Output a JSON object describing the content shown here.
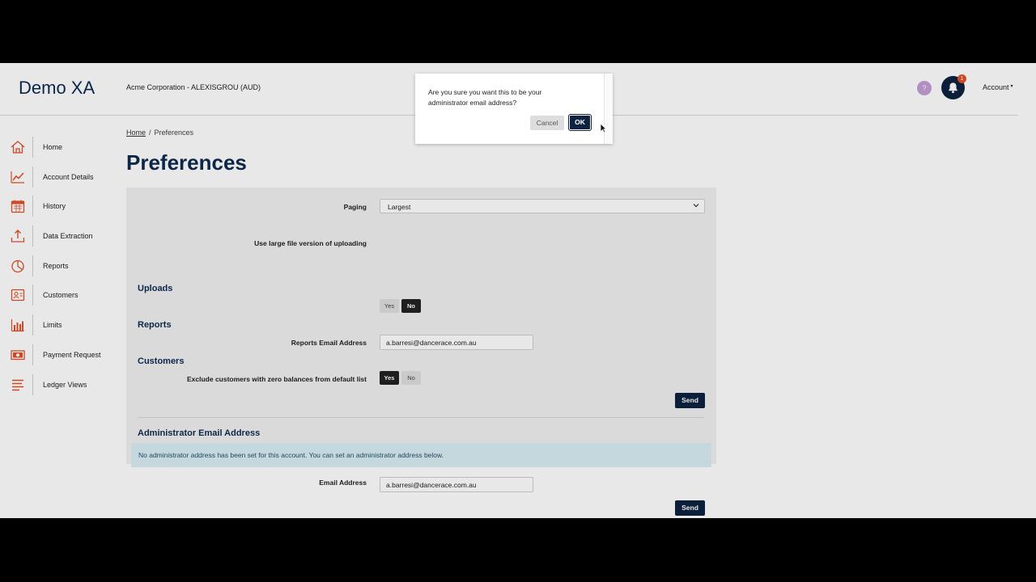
{
  "header": {
    "brand": "Demo XA",
    "organization": "Acme Corporation - ALEXISGROU (AUD)",
    "help_label": "?",
    "notification_count": "1",
    "account_label": "Account",
    "account_caret": "▾"
  },
  "sidebar": {
    "items": [
      {
        "label": "Home",
        "icon": "home-icon"
      },
      {
        "label": "Account Details",
        "icon": "line-chart-icon"
      },
      {
        "label": "History",
        "icon": "calendar-icon"
      },
      {
        "label": "Data Extraction",
        "icon": "upload-tray-icon"
      },
      {
        "label": "Reports",
        "icon": "pie-chart-icon"
      },
      {
        "label": "Customers",
        "icon": "contact-card-icon"
      },
      {
        "label": "Limits",
        "icon": "bar-chart-icon"
      },
      {
        "label": "Payment Request",
        "icon": "banknote-icon"
      },
      {
        "label": "Ledger Views",
        "icon": "lines-icon"
      }
    ],
    "icon_color": "#e0512a"
  },
  "breadcrumb": {
    "home": "Home",
    "separator": "/",
    "current": "Preferences"
  },
  "page": {
    "title": "Preferences"
  },
  "preferences": {
    "paging": {
      "label": "Paging",
      "value": "Largest"
    },
    "uploads": {
      "heading": "Uploads",
      "large_file_label": "Use large file version of uploading",
      "yes": "Yes",
      "no": "No",
      "selected": "No"
    },
    "reports": {
      "heading": "Reports",
      "email_label": "Reports Email Address",
      "email_value": "a.barresi@dancerace.com.au"
    },
    "customers": {
      "heading": "Customers",
      "exclude_label": "Exclude customers with zero balances from default list",
      "yes": "Yes",
      "no": "No",
      "selected": "Yes"
    },
    "send_label": "Send"
  },
  "administrator": {
    "heading": "Administrator Email Address",
    "info": "No administrator address has been set for this account. You can set an administrator address below.",
    "email_label": "Email Address",
    "email_value": "a.barresi@dancerace.com.au",
    "send_label": "Send"
  },
  "dialog": {
    "message": "Are you sure you want this to be your administrator email address?",
    "cancel_label": "Cancel",
    "ok_label": "OK"
  },
  "colors": {
    "brand_navy": "#0d2240",
    "accent_orange": "#e0512a",
    "info_bg": "#d9eef3"
  }
}
